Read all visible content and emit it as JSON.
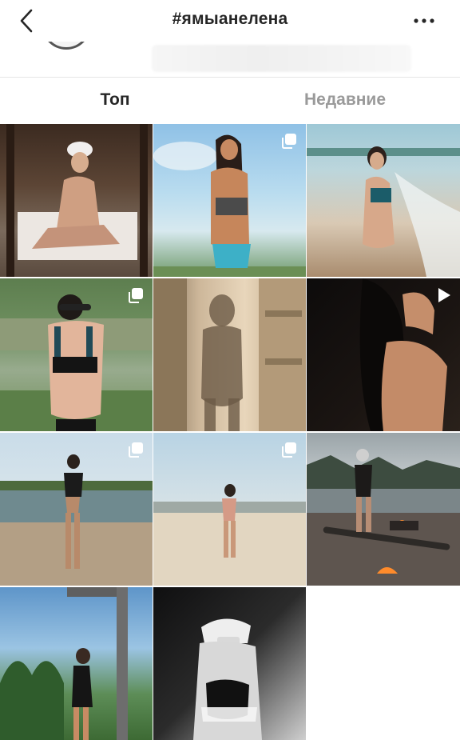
{
  "header": {
    "title": "#ямыанелена",
    "back_icon": "chevron-left-icon",
    "more_icon": "more-horizontal-icon"
  },
  "tabs": [
    {
      "label": "Топ",
      "active": true
    },
    {
      "label": "Недавние",
      "active": false
    }
  ],
  "grid": {
    "tiles": [
      {
        "id": 1,
        "badge": null
      },
      {
        "id": 2,
        "badge": "carousel-icon"
      },
      {
        "id": 3,
        "badge": null
      },
      {
        "id": 4,
        "badge": "carousel-icon"
      },
      {
        "id": 5,
        "badge": null
      },
      {
        "id": 6,
        "badge": "video-icon"
      },
      {
        "id": 7,
        "badge": "carousel-icon"
      },
      {
        "id": 8,
        "badge": "carousel-icon"
      },
      {
        "id": 9,
        "badge": null
      },
      {
        "id": 10,
        "badge": null
      },
      {
        "id": 11,
        "badge": null
      }
    ]
  },
  "colors": {
    "text_primary": "#262626",
    "text_secondary": "#9a9a9a",
    "divider": "#e6e6e6",
    "background": "#ffffff"
  }
}
